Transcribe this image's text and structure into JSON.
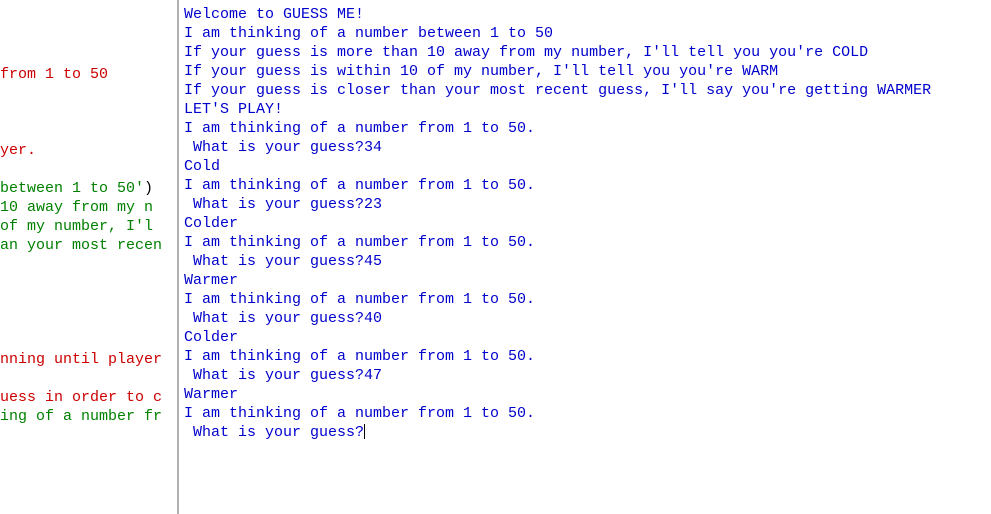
{
  "left": {
    "l1": " from 1 to 50",
    "l2": "yer.",
    "l3_a": "between 1 to 50'",
    "l3_b": ")",
    "l4": " 10 away from my n",
    "l5": " of my number, I'l",
    "l6": "an your most recen",
    "l7": "nning until player",
    "l8": "uess in order to c",
    "l9": "ing of a number fr"
  },
  "right": {
    "welcome": "Welcome to GUESS ME!",
    "intro1": "I am thinking of a number between 1 to 50",
    "intro2": "If your guess is more than 10 away from my number, I'll tell you you're COLD",
    "intro3": "If your guess is within 10 of my number, I'll tell you you're WARM",
    "intro4": "If your guess is closer than your most recent guess, I'll say you're getting WARMER",
    "play": "LET'S PLAY!",
    "think": "I am thinking of a number from 1 to 50.",
    "prompt": " What is your guess?",
    "g1": "34",
    "r1": "Cold",
    "g2": "23",
    "r2": "Colder",
    "g3": "45",
    "r3": "Warmer",
    "g4": "40",
    "r4": "Colder",
    "g5": "47",
    "r5": "Warmer"
  }
}
